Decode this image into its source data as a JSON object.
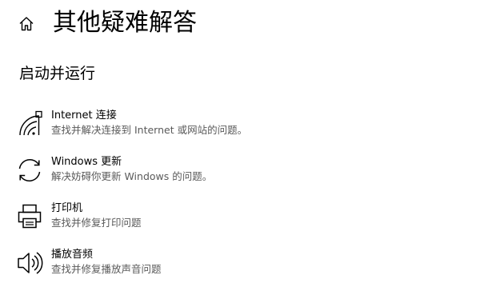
{
  "header": {
    "title": "其他疑难解答",
    "home_icon": "home-icon"
  },
  "section": {
    "title": "启动并运行"
  },
  "items": [
    {
      "name": "Internet 连接",
      "description": "查找并解决连接到 Internet 或网站的问题。",
      "icon": "wifi-signal-icon"
    },
    {
      "name": "Windows 更新",
      "description": "解决妨碍你更新 Windows 的问题。",
      "icon": "sync-arrows-icon"
    },
    {
      "name": "打印机",
      "description": "查找并修复打印问题",
      "icon": "printer-icon"
    },
    {
      "name": "播放音频",
      "description": "查找并修复播放声音问题",
      "icon": "speaker-icon"
    }
  ],
  "colors": {
    "text": "#000000",
    "secondary_text": "#5a5a5a",
    "background": "#ffffff"
  }
}
